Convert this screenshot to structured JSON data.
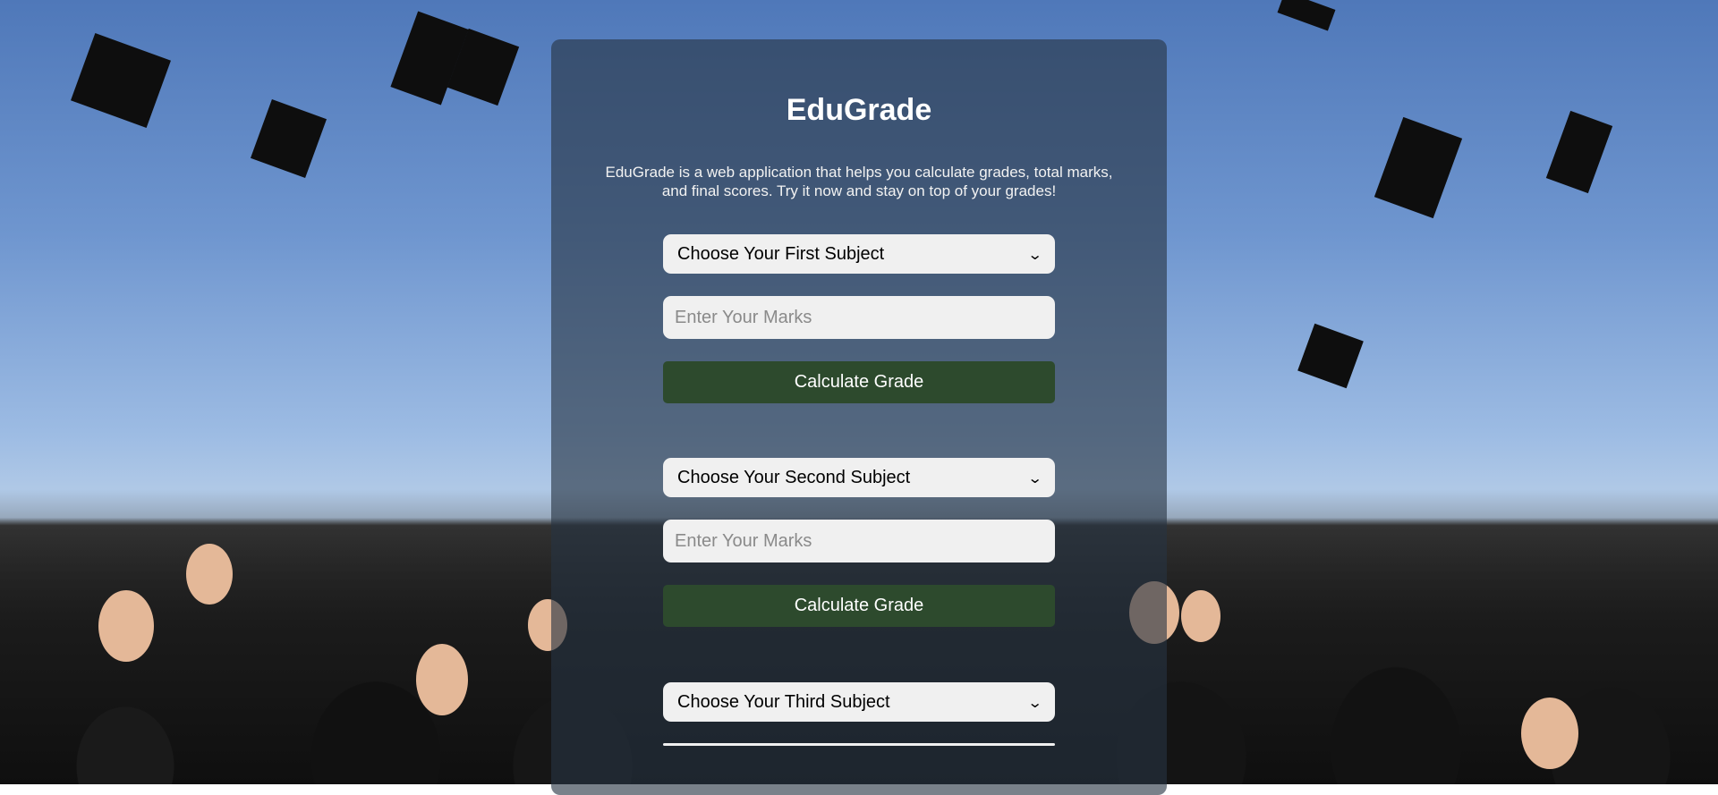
{
  "app": {
    "title": "EduGrade",
    "description": "EduGrade is a web application that helps you calculate grades, total marks, and final scores. Try it now and stay on top of your grades!"
  },
  "forms": [
    {
      "subject_select": "Choose Your First Subject",
      "marks_placeholder": "Enter Your Marks",
      "button_label": "Calculate Grade"
    },
    {
      "subject_select": "Choose Your Second Subject",
      "marks_placeholder": "Enter Your Marks",
      "button_label": "Calculate Grade"
    },
    {
      "subject_select": "Choose Your Third Subject"
    }
  ],
  "icons": {
    "select_arrow": "chevron-down-icon"
  },
  "colors": {
    "button_bg": "#2d4a2d",
    "field_bg": "#f0f0f0",
    "panel_bg": "rgba(38,52,66,0.62)"
  }
}
